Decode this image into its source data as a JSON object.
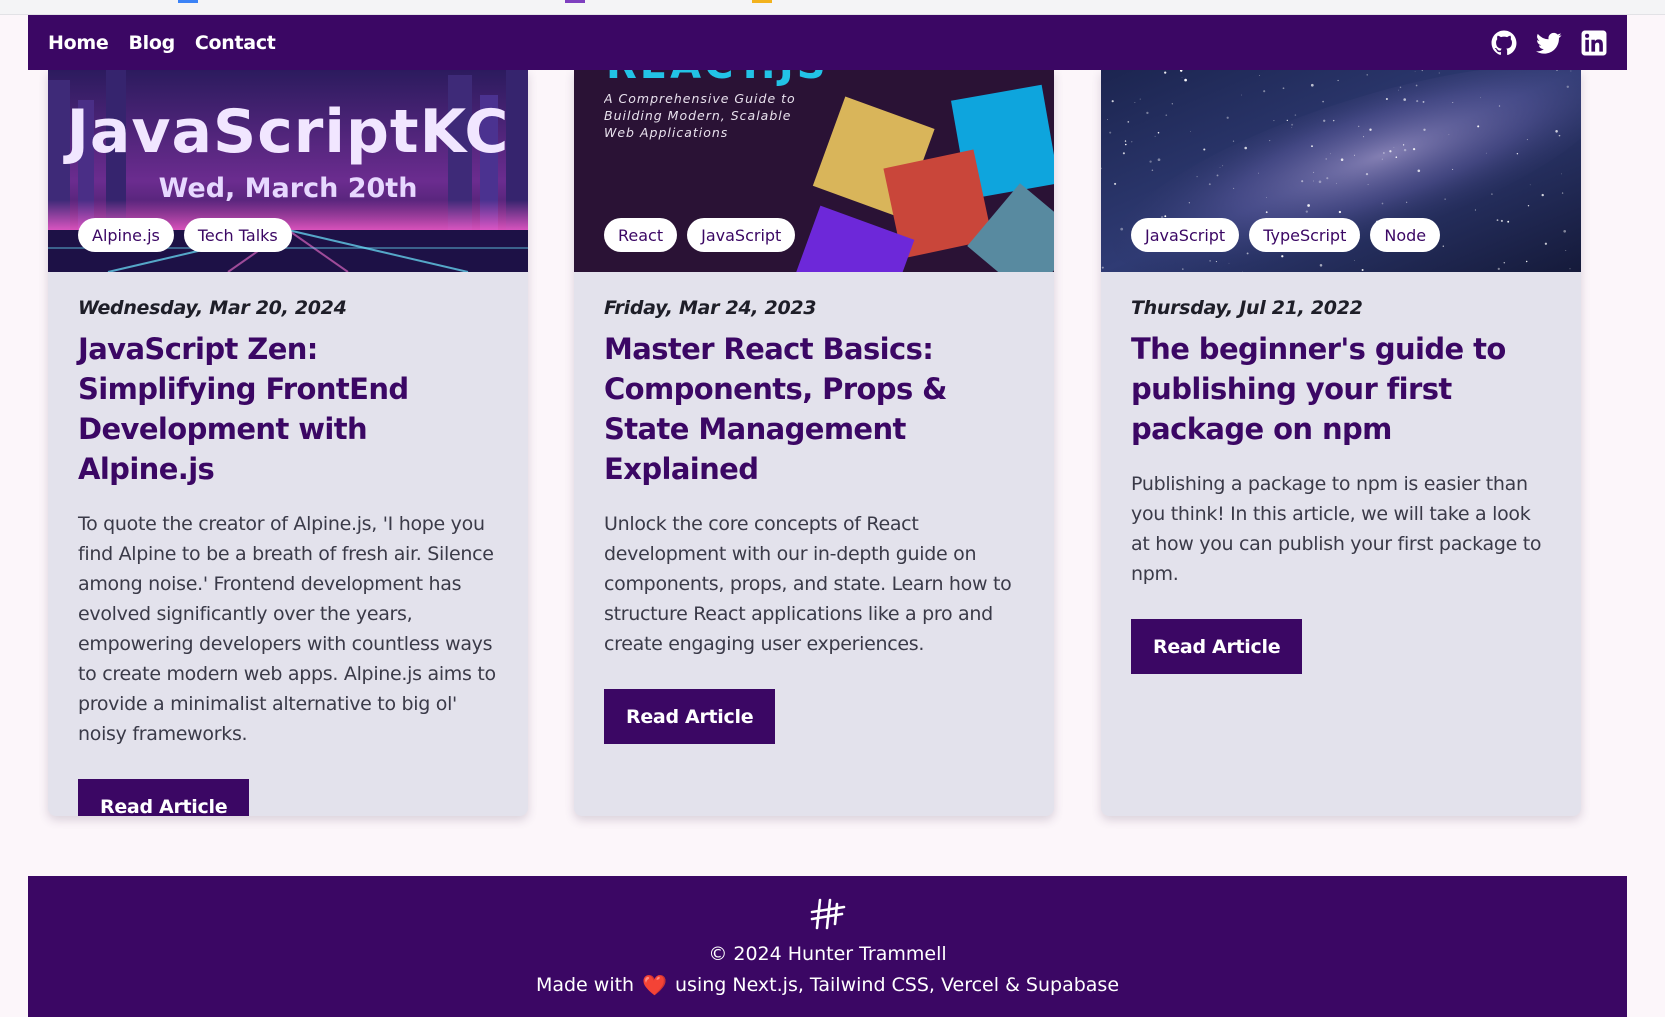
{
  "nav": {
    "links": [
      {
        "label": "Home"
      },
      {
        "label": "Blog"
      },
      {
        "label": "Contact"
      }
    ],
    "icons": [
      "github-icon",
      "twitter-icon",
      "linkedin-icon"
    ]
  },
  "cards": [
    {
      "image": {
        "headline": "JavaScriptKC",
        "subline": "Wed, March 20th"
      },
      "tags": [
        "Alpine.js",
        "Tech Talks"
      ],
      "date": "Wednesday, Mar 20, 2024",
      "title": "JavaScript Zen: Simplifying FrontEnd Development with Alpine.js",
      "excerpt": "To quote the creator of Alpine.js, 'I hope you find Alpine to be a breath of fresh air. Silence among noise.' Frontend development has evolved significantly over the years, empowering developers with countless ways to create modern web apps. Alpine.js aims to provide a minimalist alternative to big ol' noisy frameworks.",
      "button": "Read Article"
    },
    {
      "image": {
        "headline": "REACT.JS",
        "subline": "A Comprehensive Guide to Building Modern, Scalable Web Applications"
      },
      "tags": [
        "React",
        "JavaScript"
      ],
      "date": "Friday, Mar 24, 2023",
      "title": "Master React Basics: Components, Props & State Management Explained",
      "excerpt": "Unlock the core concepts of React development with our in-depth guide on components, props, and state. Learn how to structure React applications like a pro and create engaging user experiences.",
      "button": "Read Article"
    },
    {
      "image": {},
      "tags": [
        "JavaScript",
        "TypeScript",
        "Node"
      ],
      "date": "Thursday, Jul 21, 2022",
      "title": "The beginner's guide to publishing your first package on npm",
      "excerpt": "Publishing a package to npm is easier than you think! In this article, we will take a look at how you can publish your first package to npm.",
      "button": "Read Article"
    }
  ],
  "footer": {
    "copyright": "© 2024 Hunter Trammell",
    "made_prefix": "Made with",
    "heart": "❤️",
    "made_suffix": "using Next.js, Tailwind CSS, Vercel & Supabase"
  },
  "colors": {
    "brand": "#3b0764",
    "card_bg": "#e3e2ec",
    "page_bg": "#fcf6fa"
  }
}
